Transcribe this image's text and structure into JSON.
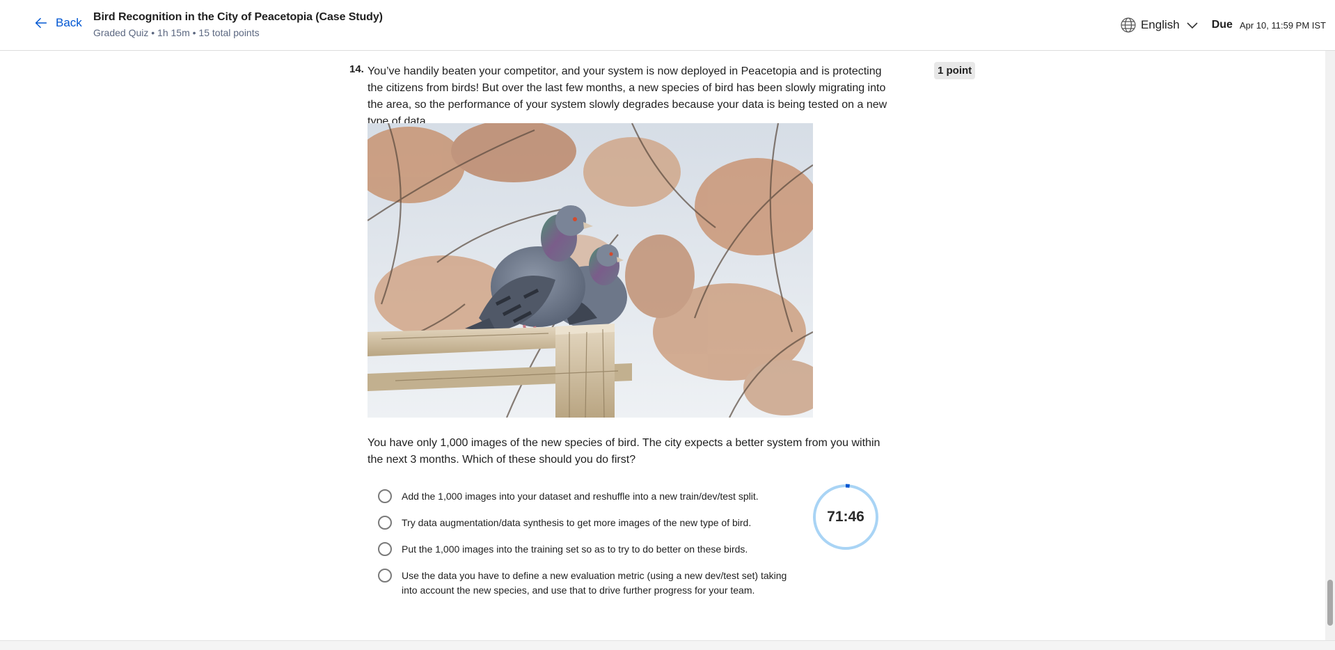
{
  "header": {
    "back_label": "Back",
    "title": "Bird Recognition in the City of Peacetopia (Case Study)",
    "subtitle": "Graded Quiz • 1h 15m • 15 total points",
    "language": "English",
    "due_label": "Due",
    "due_value": "Apr 10, 11:59 PM IST"
  },
  "question": {
    "number": "14.",
    "points": "1 point",
    "text": "You’ve handily beaten your competitor, and your system is now deployed in Peacetopia and is protecting the citizens from birds! But over the last few months, a new species of bird has been slowly migrating into the area, so the performance of your system slowly degrades because your data is being tested on a new type of data.",
    "image_icon": "pigeons-on-fence-photo",
    "followup": "You have only 1,000 images of the new species of bird. The city expects a better system from you within the next 3 months. Which of these should you do first?",
    "options": [
      "Add the 1,000 images into your dataset and reshuffle into a new train/dev/test split.",
      "Try data augmentation/data synthesis to get more images of the new type of bird.",
      "Put the 1,000 images into the training set so as to try to do better on these birds.",
      "Use the data you have to define a new evaluation metric (using a new dev/test set) taking into account the new species, and use that to drive further progress for your team."
    ]
  },
  "timer": {
    "value": "71:46",
    "elapsed_fraction": 0.02,
    "ring_color": "#a9d4f5",
    "progress_color": "#0056d2"
  },
  "colors": {
    "link": "#0056d2",
    "text": "#1f1f1f",
    "badge_bg": "#e8e8e8"
  }
}
